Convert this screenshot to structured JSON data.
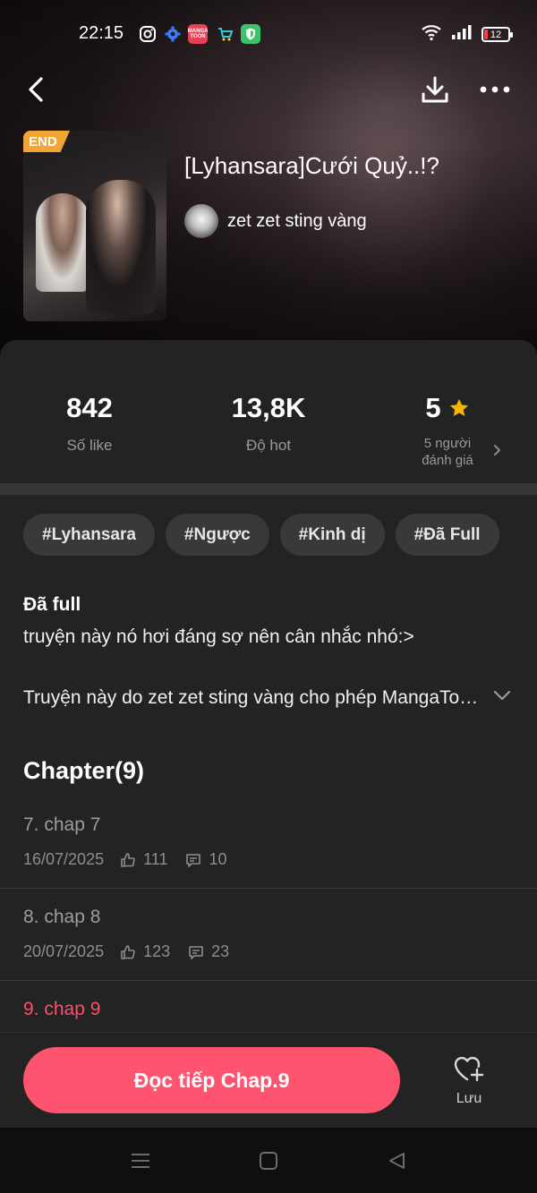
{
  "status_bar": {
    "time": "22:15",
    "battery": "12",
    "app_icons": [
      "instagram-icon",
      "settings-icon",
      "mangatoon-icon",
      "shop-icon",
      "shield-icon"
    ],
    "mangatoon_label": "MANGA TOON"
  },
  "book": {
    "badge": "END",
    "title": "[Lyhansara]Cưới Quỷ..!?",
    "author": "zet zet sting vàng"
  },
  "stats": {
    "likes_value": "842",
    "likes_label": "Số like",
    "hot_value": "13,8K",
    "hot_label": "Độ hot",
    "rating_value": "5",
    "rating_label_line1": "5 người",
    "rating_label_line2": "đánh giá"
  },
  "tags": [
    "#Lyhansara",
    "#Ngược",
    "#Kinh dị",
    "#Đã Full"
  ],
  "description": {
    "title": "Đã full",
    "body": "truyện này nó hơi đáng sợ nên cân nhắc nhó:>",
    "permission": "Truyện này do zet zet sting vàng cho phép MangaToon phát hành"
  },
  "chapters": {
    "heading": "Chapter(9)",
    "items": [
      {
        "title": "7. chap 7",
        "date": "16/07/2025",
        "likes": "111",
        "comments": "10"
      },
      {
        "title": "8. chap 8",
        "date": "20/07/2025",
        "likes": "123",
        "comments": "23"
      },
      {
        "title": "9. chap 9"
      }
    ]
  },
  "actions": {
    "read_label": "Đọc tiếp Chap.9",
    "save_label": "Lưu"
  },
  "colors": {
    "accent": "#ff5470",
    "active_chapter": "#ff4f6b",
    "badge": "#f2a435",
    "star": "#f7b500"
  }
}
